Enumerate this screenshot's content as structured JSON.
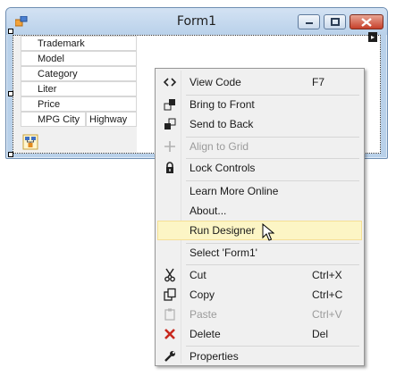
{
  "window": {
    "title": "Form1"
  },
  "form": {
    "fields": [
      "Trademark",
      "Model",
      "Category",
      "Liter",
      "Price",
      "MPG City"
    ],
    "extra_field": "Highway"
  },
  "menu": {
    "items": [
      {
        "label": "View Code",
        "shortcut": "F7",
        "icon": "view-code-icon",
        "enabled": true
      },
      {
        "label": "Bring to Front",
        "shortcut": "",
        "icon": "bring-to-front-icon",
        "enabled": true
      },
      {
        "label": "Send to Back",
        "shortcut": "",
        "icon": "send-to-back-icon",
        "enabled": true
      },
      {
        "label": "Align to Grid",
        "shortcut": "",
        "icon": "align-to-grid-icon",
        "enabled": false
      },
      {
        "label": "Lock Controls",
        "shortcut": "",
        "icon": "lock-icon",
        "enabled": true
      },
      {
        "label": "Learn More Online",
        "shortcut": "",
        "icon": "",
        "enabled": true
      },
      {
        "label": "About...",
        "shortcut": "",
        "icon": "",
        "enabled": true
      },
      {
        "label": "Run Designer",
        "shortcut": "",
        "icon": "",
        "enabled": true,
        "highlighted": true
      },
      {
        "label": "Select 'Form1'",
        "shortcut": "",
        "icon": "",
        "enabled": true
      },
      {
        "label": "Cut",
        "shortcut": "Ctrl+X",
        "icon": "scissors-icon",
        "enabled": true
      },
      {
        "label": "Copy",
        "shortcut": "Ctrl+C",
        "icon": "copy-icon",
        "enabled": true
      },
      {
        "label": "Paste",
        "shortcut": "Ctrl+V",
        "icon": "paste-icon",
        "enabled": false
      },
      {
        "label": "Delete",
        "shortcut": "Del",
        "icon": "delete-icon",
        "enabled": true
      },
      {
        "label": "Properties",
        "shortcut": "",
        "icon": "wrench-icon",
        "enabled": true
      }
    ]
  },
  "colors": {
    "highlight": "#fcf5c5",
    "close_button": "#c7402a",
    "menu_bg": "#f0f0f0"
  }
}
